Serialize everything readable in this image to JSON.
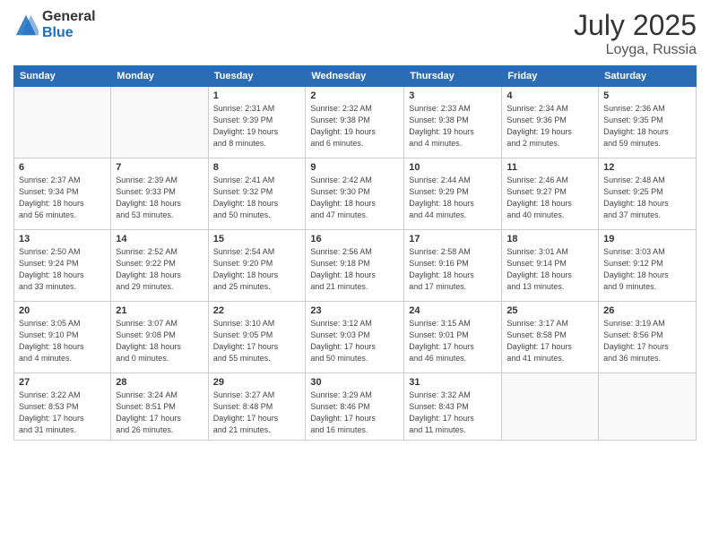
{
  "logo": {
    "general": "General",
    "blue": "Blue"
  },
  "title": {
    "month": "July 2025",
    "location": "Loyga, Russia"
  },
  "header_days": [
    "Sunday",
    "Monday",
    "Tuesday",
    "Wednesday",
    "Thursday",
    "Friday",
    "Saturday"
  ],
  "weeks": [
    [
      {
        "day": "",
        "info": ""
      },
      {
        "day": "",
        "info": ""
      },
      {
        "day": "1",
        "info": "Sunrise: 2:31 AM\nSunset: 9:39 PM\nDaylight: 19 hours\nand 8 minutes."
      },
      {
        "day": "2",
        "info": "Sunrise: 2:32 AM\nSunset: 9:38 PM\nDaylight: 19 hours\nand 6 minutes."
      },
      {
        "day": "3",
        "info": "Sunrise: 2:33 AM\nSunset: 9:38 PM\nDaylight: 19 hours\nand 4 minutes."
      },
      {
        "day": "4",
        "info": "Sunrise: 2:34 AM\nSunset: 9:36 PM\nDaylight: 19 hours\nand 2 minutes."
      },
      {
        "day": "5",
        "info": "Sunrise: 2:36 AM\nSunset: 9:35 PM\nDaylight: 18 hours\nand 59 minutes."
      }
    ],
    [
      {
        "day": "6",
        "info": "Sunrise: 2:37 AM\nSunset: 9:34 PM\nDaylight: 18 hours\nand 56 minutes."
      },
      {
        "day": "7",
        "info": "Sunrise: 2:39 AM\nSunset: 9:33 PM\nDaylight: 18 hours\nand 53 minutes."
      },
      {
        "day": "8",
        "info": "Sunrise: 2:41 AM\nSunset: 9:32 PM\nDaylight: 18 hours\nand 50 minutes."
      },
      {
        "day": "9",
        "info": "Sunrise: 2:42 AM\nSunset: 9:30 PM\nDaylight: 18 hours\nand 47 minutes."
      },
      {
        "day": "10",
        "info": "Sunrise: 2:44 AM\nSunset: 9:29 PM\nDaylight: 18 hours\nand 44 minutes."
      },
      {
        "day": "11",
        "info": "Sunrise: 2:46 AM\nSunset: 9:27 PM\nDaylight: 18 hours\nand 40 minutes."
      },
      {
        "day": "12",
        "info": "Sunrise: 2:48 AM\nSunset: 9:25 PM\nDaylight: 18 hours\nand 37 minutes."
      }
    ],
    [
      {
        "day": "13",
        "info": "Sunrise: 2:50 AM\nSunset: 9:24 PM\nDaylight: 18 hours\nand 33 minutes."
      },
      {
        "day": "14",
        "info": "Sunrise: 2:52 AM\nSunset: 9:22 PM\nDaylight: 18 hours\nand 29 minutes."
      },
      {
        "day": "15",
        "info": "Sunrise: 2:54 AM\nSunset: 9:20 PM\nDaylight: 18 hours\nand 25 minutes."
      },
      {
        "day": "16",
        "info": "Sunrise: 2:56 AM\nSunset: 9:18 PM\nDaylight: 18 hours\nand 21 minutes."
      },
      {
        "day": "17",
        "info": "Sunrise: 2:58 AM\nSunset: 9:16 PM\nDaylight: 18 hours\nand 17 minutes."
      },
      {
        "day": "18",
        "info": "Sunrise: 3:01 AM\nSunset: 9:14 PM\nDaylight: 18 hours\nand 13 minutes."
      },
      {
        "day": "19",
        "info": "Sunrise: 3:03 AM\nSunset: 9:12 PM\nDaylight: 18 hours\nand 9 minutes."
      }
    ],
    [
      {
        "day": "20",
        "info": "Sunrise: 3:05 AM\nSunset: 9:10 PM\nDaylight: 18 hours\nand 4 minutes."
      },
      {
        "day": "21",
        "info": "Sunrise: 3:07 AM\nSunset: 9:08 PM\nDaylight: 18 hours\nand 0 minutes."
      },
      {
        "day": "22",
        "info": "Sunrise: 3:10 AM\nSunset: 9:05 PM\nDaylight: 17 hours\nand 55 minutes."
      },
      {
        "day": "23",
        "info": "Sunrise: 3:12 AM\nSunset: 9:03 PM\nDaylight: 17 hours\nand 50 minutes."
      },
      {
        "day": "24",
        "info": "Sunrise: 3:15 AM\nSunset: 9:01 PM\nDaylight: 17 hours\nand 46 minutes."
      },
      {
        "day": "25",
        "info": "Sunrise: 3:17 AM\nSunset: 8:58 PM\nDaylight: 17 hours\nand 41 minutes."
      },
      {
        "day": "26",
        "info": "Sunrise: 3:19 AM\nSunset: 8:56 PM\nDaylight: 17 hours\nand 36 minutes."
      }
    ],
    [
      {
        "day": "27",
        "info": "Sunrise: 3:22 AM\nSunset: 8:53 PM\nDaylight: 17 hours\nand 31 minutes."
      },
      {
        "day": "28",
        "info": "Sunrise: 3:24 AM\nSunset: 8:51 PM\nDaylight: 17 hours\nand 26 minutes."
      },
      {
        "day": "29",
        "info": "Sunrise: 3:27 AM\nSunset: 8:48 PM\nDaylight: 17 hours\nand 21 minutes."
      },
      {
        "day": "30",
        "info": "Sunrise: 3:29 AM\nSunset: 8:46 PM\nDaylight: 17 hours\nand 16 minutes."
      },
      {
        "day": "31",
        "info": "Sunrise: 3:32 AM\nSunset: 8:43 PM\nDaylight: 17 hours\nand 11 minutes."
      },
      {
        "day": "",
        "info": ""
      },
      {
        "day": "",
        "info": ""
      }
    ]
  ]
}
